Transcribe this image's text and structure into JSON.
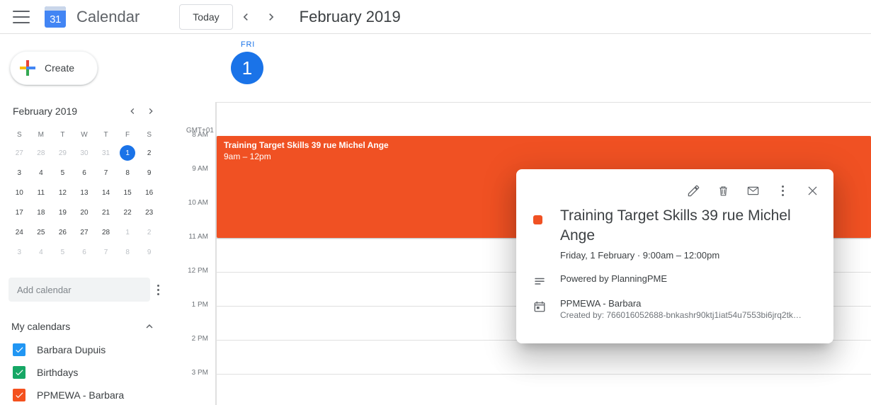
{
  "topbar": {
    "menu_icon": "hamburger-icon",
    "logo_icon": "google-calendar-logo",
    "logo_day": "31",
    "app_title": "Calendar",
    "today_label": "Today",
    "prev_icon": "chevron-left-icon",
    "next_icon": "chevron-right-icon",
    "current_range": "February 2019"
  },
  "sidebar": {
    "create_label": "Create",
    "create_icon": "google-plus-icon",
    "mini_calendar": {
      "title": "February 2019",
      "prev_icon": "chevron-left-icon",
      "next_icon": "chevron-right-icon",
      "weekday_headers": [
        "S",
        "M",
        "T",
        "W",
        "T",
        "F",
        "S"
      ],
      "weeks": [
        [
          {
            "d": "27",
            "muted": true
          },
          {
            "d": "28",
            "muted": true
          },
          {
            "d": "29",
            "muted": true
          },
          {
            "d": "30",
            "muted": true
          },
          {
            "d": "31",
            "muted": true
          },
          {
            "d": "1",
            "muted": false,
            "selected": true
          },
          {
            "d": "2",
            "muted": false
          }
        ],
        [
          {
            "d": "3",
            "muted": false
          },
          {
            "d": "4",
            "muted": false
          },
          {
            "d": "5",
            "muted": false
          },
          {
            "d": "6",
            "muted": false
          },
          {
            "d": "7",
            "muted": false
          },
          {
            "d": "8",
            "muted": false
          },
          {
            "d": "9",
            "muted": false
          }
        ],
        [
          {
            "d": "10",
            "muted": false
          },
          {
            "d": "11",
            "muted": false
          },
          {
            "d": "12",
            "muted": false
          },
          {
            "d": "13",
            "muted": false
          },
          {
            "d": "14",
            "muted": false
          },
          {
            "d": "15",
            "muted": false
          },
          {
            "d": "16",
            "muted": false
          }
        ],
        [
          {
            "d": "17",
            "muted": false
          },
          {
            "d": "18",
            "muted": false
          },
          {
            "d": "19",
            "muted": false
          },
          {
            "d": "20",
            "muted": false
          },
          {
            "d": "21",
            "muted": false
          },
          {
            "d": "22",
            "muted": false
          },
          {
            "d": "23",
            "muted": false
          }
        ],
        [
          {
            "d": "24",
            "muted": false
          },
          {
            "d": "25",
            "muted": false
          },
          {
            "d": "26",
            "muted": false
          },
          {
            "d": "27",
            "muted": false
          },
          {
            "d": "28",
            "muted": false
          },
          {
            "d": "1",
            "muted": true
          },
          {
            "d": "2",
            "muted": true
          }
        ],
        [
          {
            "d": "3",
            "muted": true
          },
          {
            "d": "4",
            "muted": true
          },
          {
            "d": "5",
            "muted": true
          },
          {
            "d": "6",
            "muted": true
          },
          {
            "d": "7",
            "muted": true
          },
          {
            "d": "8",
            "muted": true
          },
          {
            "d": "9",
            "muted": true
          }
        ]
      ],
      "selected_accent": "#1a73e8"
    },
    "add_calendar_placeholder": "Add calendar",
    "add_calendar_value": "",
    "options_icon": "more-vertical-icon",
    "my_calendars_label": "My calendars",
    "collapse_icon": "chevron-up-icon",
    "calendars": [
      {
        "label": "Barbara Dupuis",
        "color": "#2196f3",
        "checked": true
      },
      {
        "label": "Birthdays",
        "color": "#16a765",
        "checked": true
      },
      {
        "label": "PPMEWA - Barbara",
        "color": "#f4511e",
        "checked": true
      }
    ]
  },
  "main": {
    "day": {
      "weekday": "FRI",
      "number": "1",
      "accent": "#1a73e8"
    },
    "timezone_label": "GMT+01",
    "hour_labels": [
      "8 AM",
      "9 AM",
      "10 AM",
      "11 AM",
      "12 PM",
      "1 PM",
      "2 PM",
      "3 PM"
    ],
    "event": {
      "title": "Training Target Skills 39 rue Michel Ange",
      "time": "9am – 12pm",
      "color": "#f05123"
    }
  },
  "popup": {
    "actions": {
      "edit_icon": "pencil-icon",
      "delete_icon": "trash-icon",
      "email_icon": "envelope-icon",
      "more_icon": "more-vertical-icon",
      "close_icon": "close-icon"
    },
    "color_swatch": "#f05123",
    "title": "Training Target Skills 39 rue Michel Ange",
    "when": "Friday, 1 February  ·  9:00am – 12:00pm",
    "description_icon": "description-icon",
    "description": "Powered by PlanningPME",
    "calendar_icon": "calendar-icon",
    "calendar_name": "PPMEWA - Barbara",
    "created_by": "Created by: 766016052688-bnkashr90ktj1iat54u7553bi6jrq2tk…"
  }
}
